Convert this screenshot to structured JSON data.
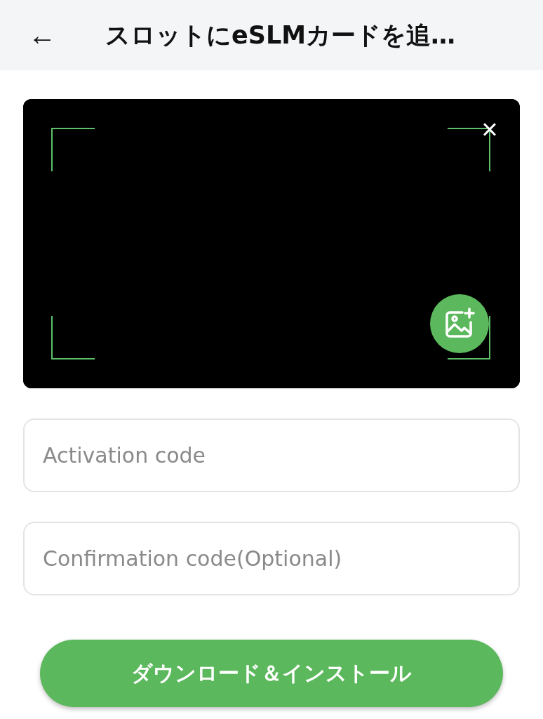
{
  "header": {
    "back_icon": "←",
    "title": "スロットにeSLMカードを追…"
  },
  "scanner": {
    "close_icon": "×"
  },
  "fields": [
    {
      "placeholder": "Activation code"
    },
    {
      "placeholder": "Confirmation code(Optional)"
    }
  ],
  "button": {
    "label": "ダウンロード＆インストール"
  }
}
